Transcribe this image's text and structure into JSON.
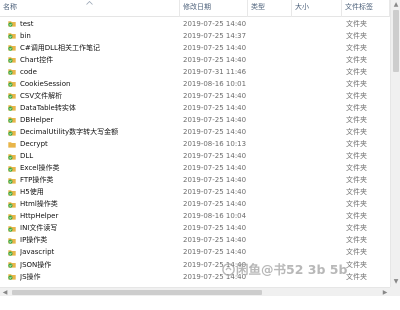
{
  "columns": {
    "name": "名称",
    "date": "修改日期",
    "type": "类型",
    "size": "大小",
    "tags": "文件标签"
  },
  "rows": [
    {
      "name": "test",
      "date": "2019-07-25 14:40",
      "type": "文件夹",
      "icon": "folder-sync-icon"
    },
    {
      "name": "bin",
      "date": "2019-07-25 14:37",
      "type": "文件夹",
      "icon": "folder-sync-icon"
    },
    {
      "name": "C#调用DLL相关工作笔记",
      "date": "2019-07-25 14:40",
      "type": "文件夹",
      "icon": "folder-sync-icon"
    },
    {
      "name": "Chart控件",
      "date": "2019-07-25 14:40",
      "type": "文件夹",
      "icon": "folder-sync-icon"
    },
    {
      "name": "code",
      "date": "2019-07-31 11:46",
      "type": "文件夹",
      "icon": "folder-sync-icon"
    },
    {
      "name": "CookieSession",
      "date": "2019-08-16 10:01",
      "type": "文件夹",
      "icon": "folder-sync-icon"
    },
    {
      "name": "CSV文件解析",
      "date": "2019-07-25 14:40",
      "type": "文件夹",
      "icon": "folder-sync-icon"
    },
    {
      "name": "DataTable转实体",
      "date": "2019-07-25 14:40",
      "type": "文件夹",
      "icon": "folder-sync-icon"
    },
    {
      "name": "DBHelper",
      "date": "2019-07-25 14:40",
      "type": "文件夹",
      "icon": "folder-sync-icon"
    },
    {
      "name": "DecimalUtility数字转大写金额",
      "date": "2019-07-25 14:40",
      "type": "文件夹",
      "icon": "folder-sync-icon"
    },
    {
      "name": "Decrypt",
      "date": "2019-08-16 10:13",
      "type": "文件夹",
      "icon": "folder-plain-icon"
    },
    {
      "name": "DLL",
      "date": "2019-07-25 14:40",
      "type": "文件夹",
      "icon": "folder-sync-icon"
    },
    {
      "name": "Excel操作类",
      "date": "2019-07-25 14:40",
      "type": "文件夹",
      "icon": "folder-sync-icon"
    },
    {
      "name": "FTP操作类",
      "date": "2019-07-25 14:40",
      "type": "文件夹",
      "icon": "folder-sync-icon"
    },
    {
      "name": "H5使用",
      "date": "2019-07-25 14:40",
      "type": "文件夹",
      "icon": "folder-sync-icon"
    },
    {
      "name": "Html操作类",
      "date": "2019-07-25 14:40",
      "type": "文件夹",
      "icon": "folder-sync-icon"
    },
    {
      "name": "HttpHelper",
      "date": "2019-08-16 10:04",
      "type": "文件夹",
      "icon": "folder-sync-icon"
    },
    {
      "name": "INI文件读写",
      "date": "2019-07-25 14:40",
      "type": "文件夹",
      "icon": "folder-sync-icon"
    },
    {
      "name": "IP操作类",
      "date": "2019-07-25 14:40",
      "type": "文件夹",
      "icon": "folder-sync-icon"
    },
    {
      "name": "Javascript",
      "date": "2019-07-25 14:40",
      "type": "文件夹",
      "icon": "folder-sync-icon"
    },
    {
      "name": "JSON操作",
      "date": "2019-07-25 14:40",
      "type": "文件夹",
      "icon": "folder-sync-icon"
    },
    {
      "name": "JS操作",
      "date": "2019-07-25 14:40",
      "type": "文件夹",
      "icon": "folder-sync-icon"
    }
  ],
  "watermark": "闲鱼@书52 3b 5b",
  "colors": {
    "folder": "#e8b54a",
    "sync_badge": "#3da83d",
    "header_text": "#4c607a",
    "meta_text": "#6d6d6d"
  }
}
